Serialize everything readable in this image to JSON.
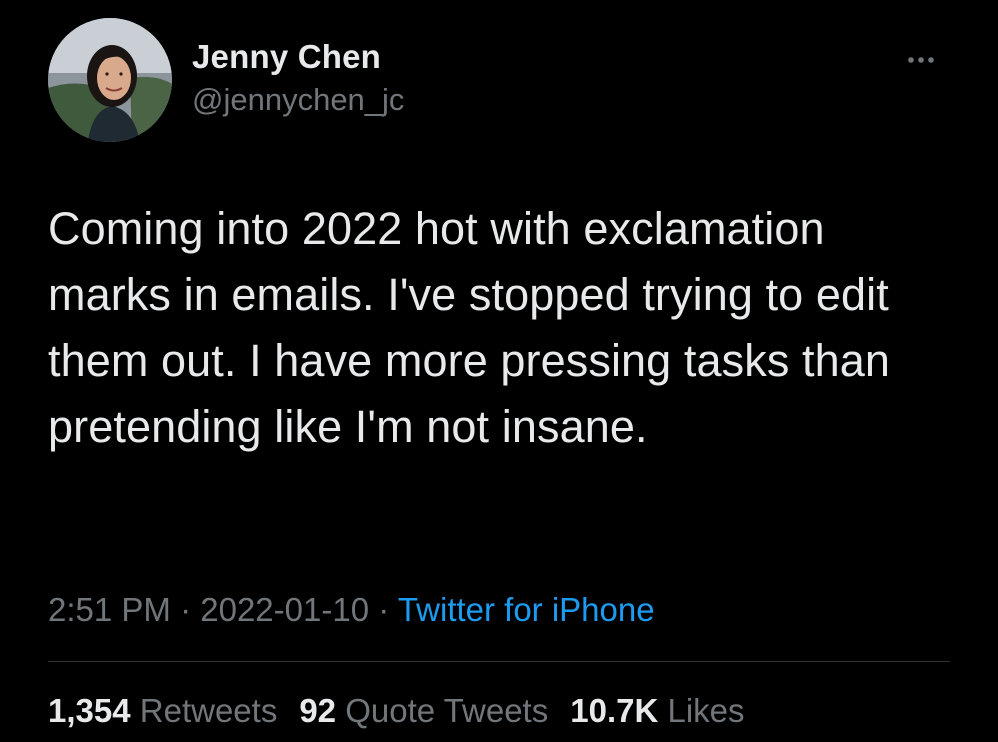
{
  "colors": {
    "background": "#000000",
    "primary_text": "#e7e9ea",
    "secondary_text": "#71767b",
    "link": "#1d9bf0",
    "divider": "#2f3336"
  },
  "author": {
    "display_name": "Jenny Chen",
    "handle": "@jennychen_jc",
    "avatar_icon": "profile-photo"
  },
  "more_icon": "ellipsis-icon",
  "tweet": {
    "text": "Coming into 2022 hot with exclamation marks in emails. I've stopped trying to edit them out. I have more pressing tasks than pretending like I'm not insane."
  },
  "meta": {
    "time": "2:51 PM",
    "separator": "·",
    "date": "2022-01-10",
    "source": "Twitter for iPhone"
  },
  "stats": {
    "retweets_count": "1,354",
    "retweets_label": "Retweets",
    "quotes_count": "92",
    "quotes_label": "Quote Tweets",
    "likes_count": "10.7K",
    "likes_label": "Likes"
  }
}
